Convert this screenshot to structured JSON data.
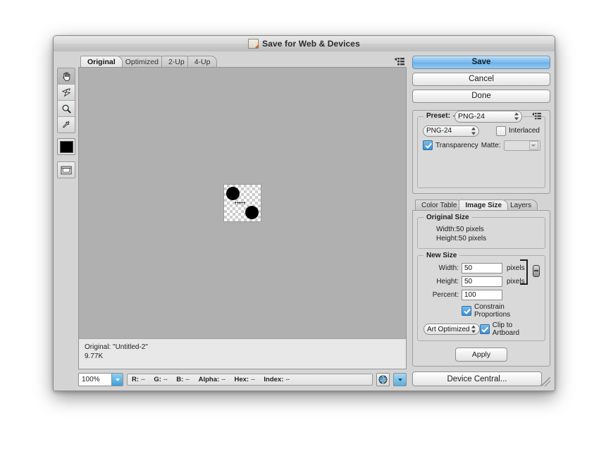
{
  "window": {
    "title": "Save for Web & Devices",
    "icon": "photoshop-document-icon"
  },
  "toolbox": {
    "tools": [
      {
        "name": "hand-tool",
        "glyph": "hand"
      },
      {
        "name": "slice-select-tool",
        "glyph": "slice-select"
      },
      {
        "name": "zoom-tool",
        "glyph": "magnifier"
      },
      {
        "name": "eyedropper-tool",
        "glyph": "eyedropper"
      }
    ],
    "foreground_swatch_color": "#000000",
    "slice_visibility_toggle": "toggle-slice-visibility"
  },
  "preview": {
    "tabs": [
      {
        "label": "Original",
        "active": true
      },
      {
        "label": "Optimized",
        "active": false
      },
      {
        "label": "2-Up",
        "active": false
      },
      {
        "label": "4-Up",
        "active": false
      }
    ],
    "panel_menu": "panel-menu-icon",
    "canvas_background": "#b0b0b0",
    "status": {
      "line1": "Original: \"Untitled-2\"",
      "line2": "9.77K"
    }
  },
  "bottombar": {
    "zoom_level": "100%",
    "readouts": [
      {
        "key": "R:",
        "value": "--"
      },
      {
        "key": "G:",
        "value": "--"
      },
      {
        "key": "B:",
        "value": "--"
      },
      {
        "key": "Alpha:",
        "value": "--"
      },
      {
        "key": "Hex:",
        "value": "--"
      },
      {
        "key": "Index:",
        "value": "--"
      }
    ],
    "preview_browser_icon": "globe-icon",
    "preview_dropdown": "preview-in-browser-dropdown"
  },
  "actions": {
    "save": "Save",
    "cancel": "Cancel",
    "done": "Done",
    "device_central": "Device Central...",
    "apply": "Apply"
  },
  "settings": {
    "preset_label": "Preset:",
    "preset_value": "PNG-24",
    "format_value": "PNG-24",
    "interlaced_label": "Interlaced",
    "interlaced_checked": false,
    "transparency_label": "Transparency",
    "transparency_checked": true,
    "matte_label": "Matte:",
    "matte_value": ""
  },
  "image_size": {
    "tabs": [
      {
        "label": "Color Table",
        "active": false
      },
      {
        "label": "Image Size",
        "active": true
      },
      {
        "label": "Layers",
        "active": false
      }
    ],
    "original_size": {
      "legend": "Original Size",
      "width": "Width:50 pixels",
      "height": "Height:50 pixels"
    },
    "new_size": {
      "legend": "New Size",
      "width_label": "Width:",
      "width_value": "50",
      "width_unit": "pixels",
      "height_label": "Height:",
      "height_value": "50",
      "height_unit": "pixels",
      "percent_label": "Percent:",
      "percent_value": "100",
      "constrain_label": "Constrain Proportions",
      "constrain_checked": true,
      "quality_value": "Art Optimized",
      "clip_label": "Clip to Artboard",
      "clip_checked": true
    }
  },
  "colors": {
    "accent": "#6cb0e7",
    "checkbox_on": "#3d8fd6",
    "canvas": "#b0b0b0"
  }
}
